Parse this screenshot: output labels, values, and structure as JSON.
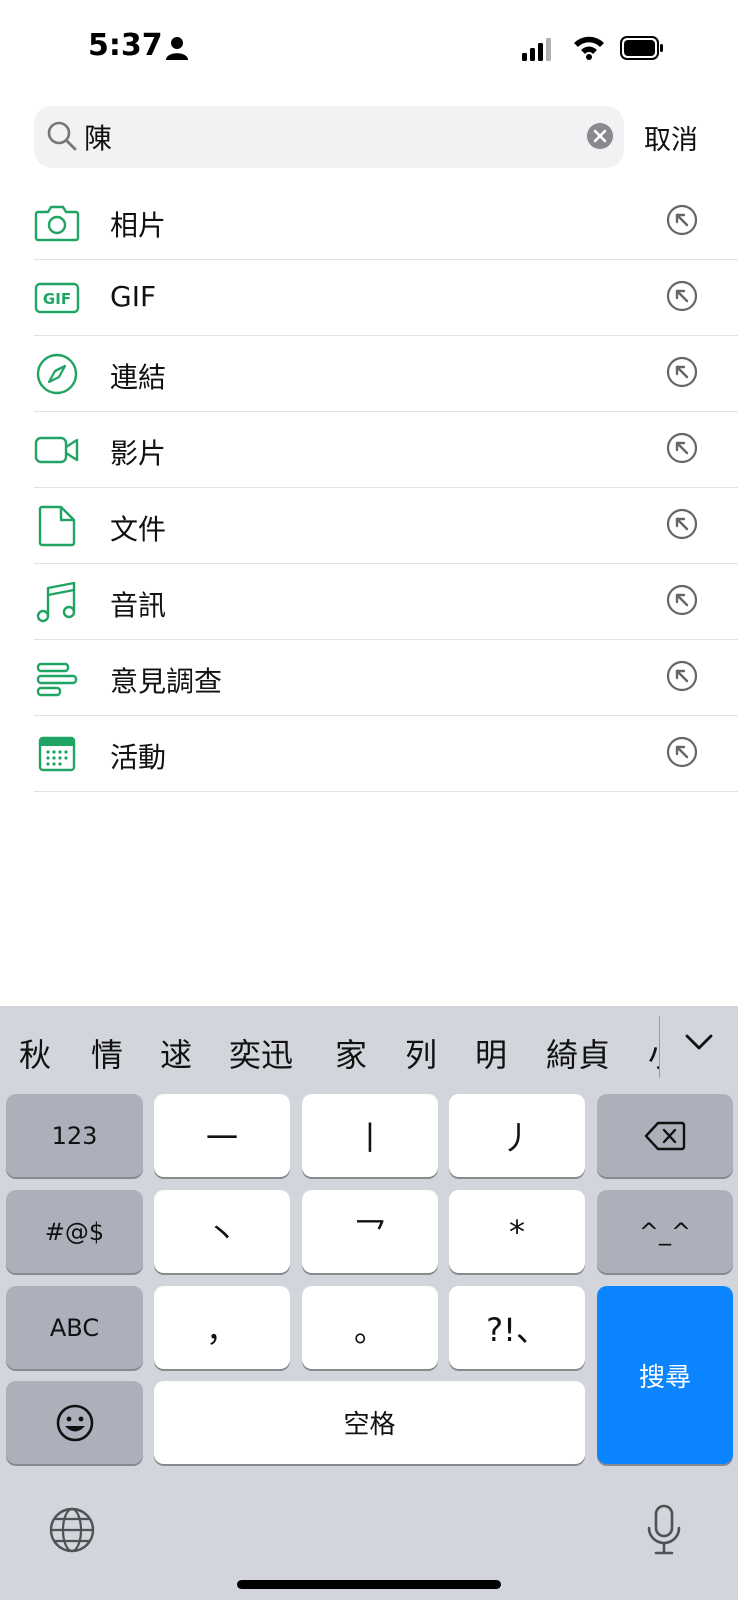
{
  "status_bar": {
    "time": "5:37"
  },
  "search": {
    "query": "陳",
    "cancel_label": "取消"
  },
  "categories": [
    {
      "label": "相片",
      "icon": "camera-icon"
    },
    {
      "label": "GIF",
      "icon": "gif-icon",
      "icon_text": "GIF"
    },
    {
      "label": "連結",
      "icon": "compass-icon"
    },
    {
      "label": "影片",
      "icon": "video-icon"
    },
    {
      "label": "文件",
      "icon": "document-icon"
    },
    {
      "label": "音訊",
      "icon": "music-note-icon"
    },
    {
      "label": "意見調查",
      "icon": "poll-icon"
    },
    {
      "label": "活動",
      "icon": "calendar-icon"
    }
  ],
  "theme": {
    "accent": "#1fa463",
    "keyboard_bg": "#d2d5db",
    "search_key": "#0a84ff"
  },
  "keyboard": {
    "candidates": [
      "秋",
      "情",
      "逑",
      "奕迅",
      "家",
      "列",
      "明",
      "綺貞",
      "小"
    ],
    "keys": {
      "numbers": "123",
      "k1": "一",
      "k2": "丨",
      "k3": "丿",
      "symbols": "#@$",
      "k4": "丶",
      "k5": "乛",
      "k6": "*",
      "kaomoji": "^_^",
      "abc": "ABC",
      "k7": "，",
      "k8": "。",
      "k9": "?!、",
      "space": "空格",
      "search": "搜尋"
    }
  }
}
